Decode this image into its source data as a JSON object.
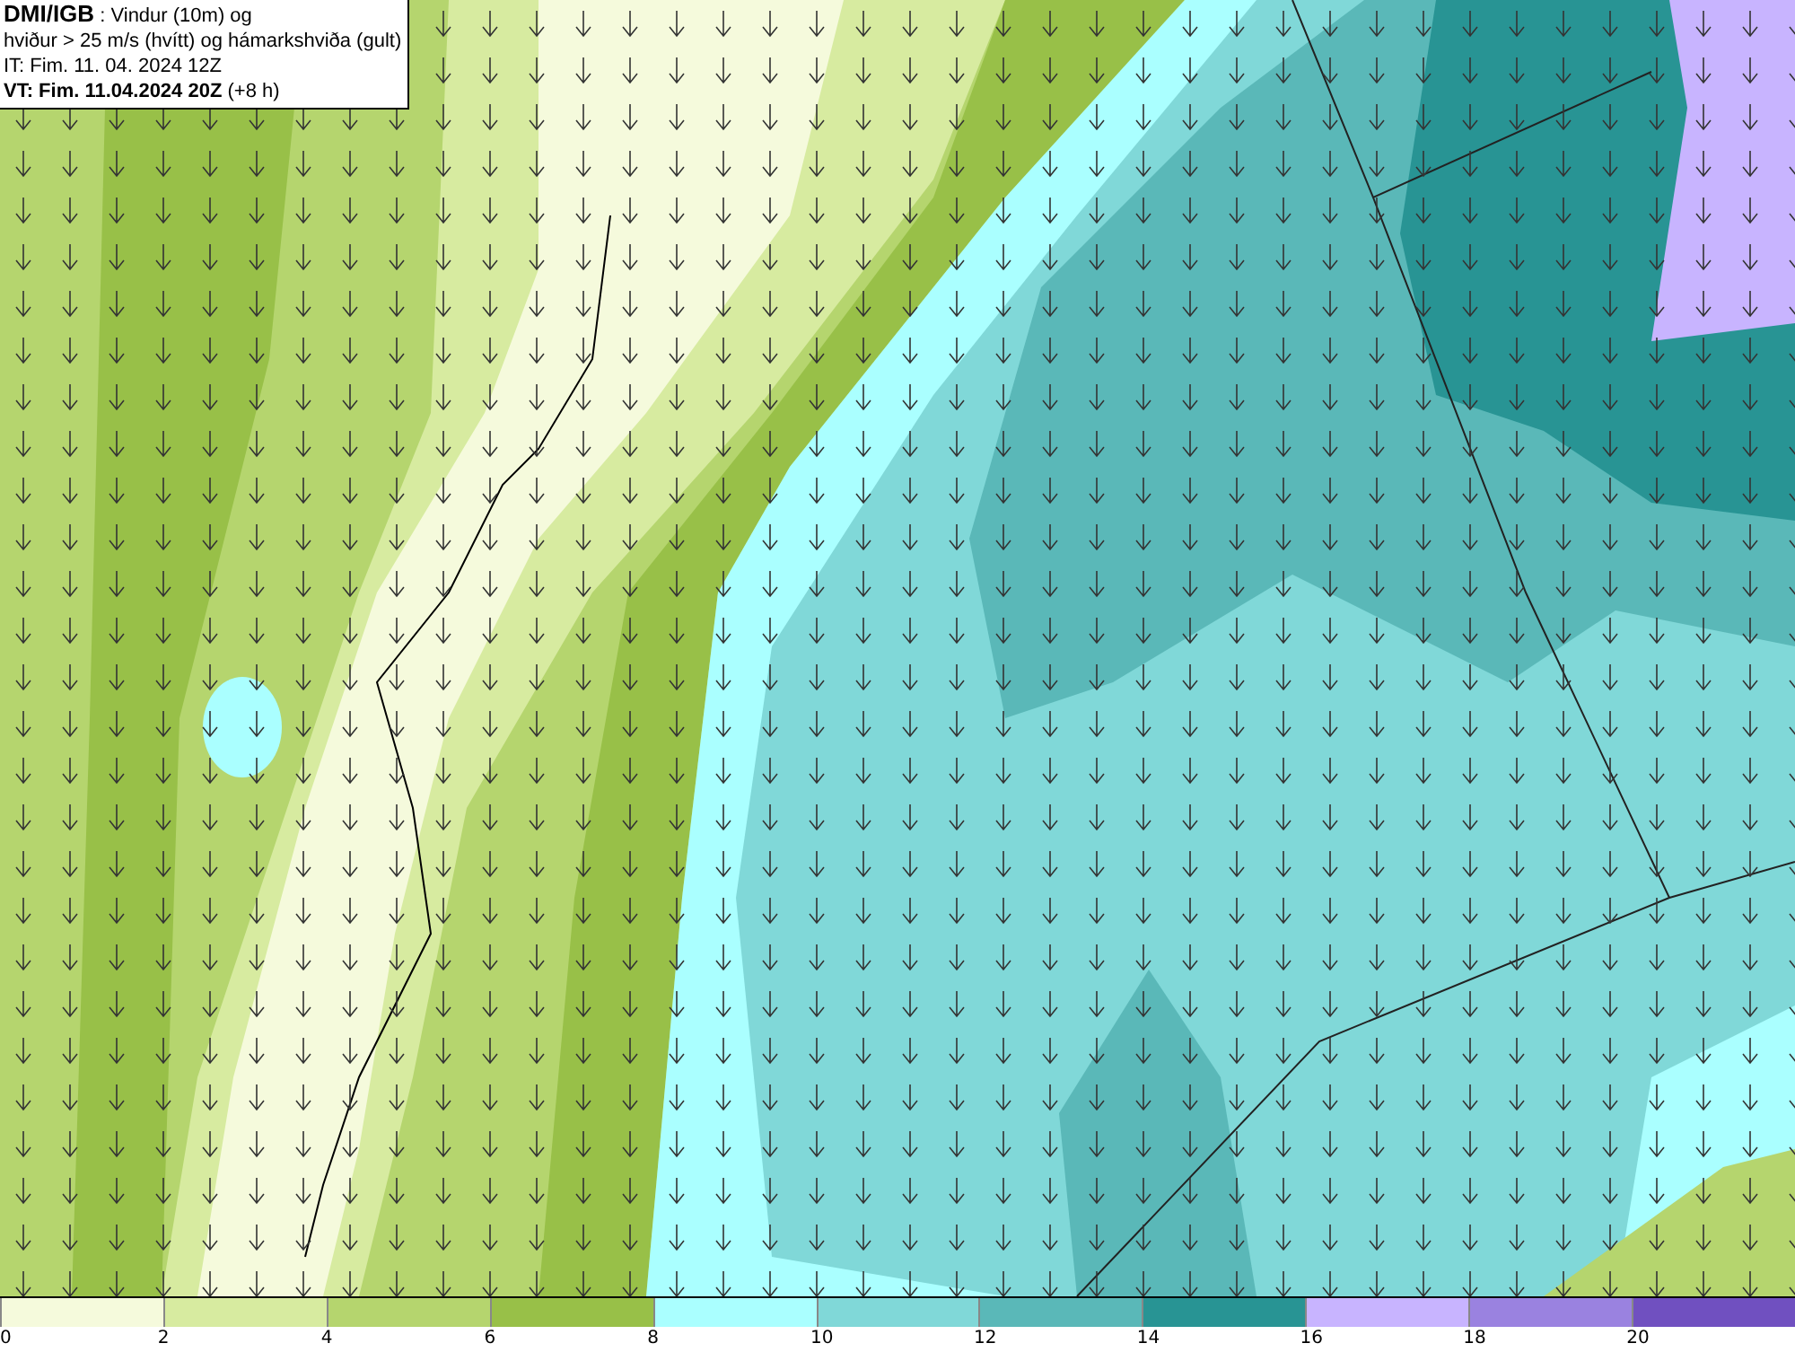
{
  "header": {
    "lines": [
      "**DMI/IGB** : Vindur (10m) og",
      "hviður > 25 m/s (hvítt) og hámarkshviða (gult)",
      "IT: Fim. 11. 04. 2024 12Z",
      "**VT: Fim. 11.04.2024 20Z** (+8 h)"
    ]
  },
  "legend": {
    "bands": [
      {
        "color": "#f5fadc"
      },
      {
        "color": "#d7eba0"
      },
      {
        "color": "#b5d56e"
      },
      {
        "color": "#98c048"
      },
      {
        "color": "#aaffff"
      },
      {
        "color": "#80d8d8"
      },
      {
        "color": "#5ab8b8"
      },
      {
        "color": "#289494"
      },
      {
        "color": "#c8b4ff"
      },
      {
        "color": "#9a82e0"
      },
      {
        "color": "#7050c0"
      }
    ],
    "ticks": [
      "0",
      "2",
      "4",
      "6",
      "8",
      "10",
      "12",
      "14",
      "16",
      "18",
      "20"
    ]
  }
}
